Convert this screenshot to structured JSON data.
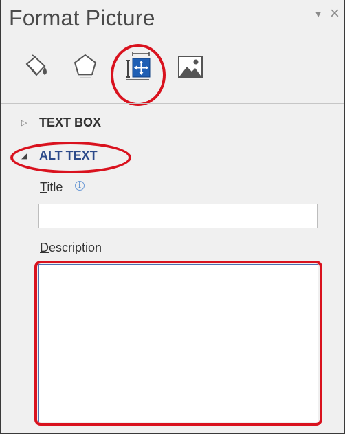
{
  "pane": {
    "title": "Format Picture",
    "dropdown_icon": "▼",
    "close_icon": "×"
  },
  "tabs": [
    {
      "name": "fill-line-icon",
      "active": false
    },
    {
      "name": "effects-icon",
      "active": false
    },
    {
      "name": "layout-properties-icon",
      "active": true
    },
    {
      "name": "picture-icon",
      "active": false
    }
  ],
  "sections": {
    "text_box": {
      "label": "TEXT BOX",
      "expanded": false,
      "arrow": "▷"
    },
    "alt_text": {
      "label": "ALT TEXT",
      "expanded": true,
      "arrow": "◢"
    }
  },
  "alt_text": {
    "title_label_mnemonic": "T",
    "title_label_rest": "itle",
    "title_info": "i",
    "title_value": "",
    "description_label_mnemonic": "D",
    "description_label_rest": "escription",
    "description_value": ""
  },
  "colors": {
    "annotation_red": "#d9121e",
    "section_active_blue": "#2c4a8a",
    "icon_blue": "#1f5fb4"
  }
}
